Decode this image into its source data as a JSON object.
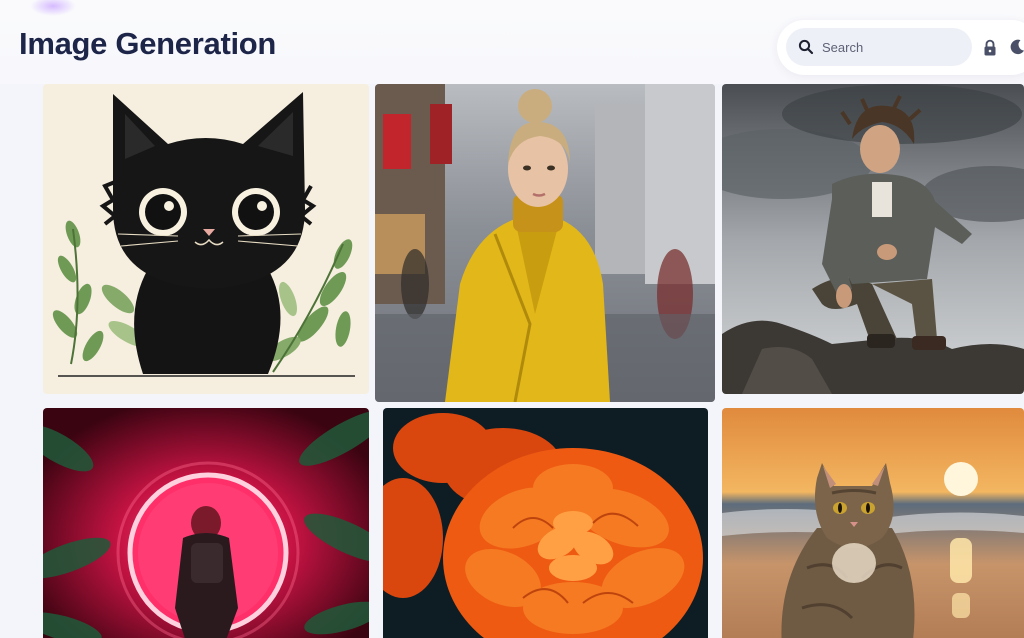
{
  "header": {
    "title": "Image Generation"
  },
  "search": {
    "placeholder": "Search"
  },
  "icons": {
    "search": "search-icon",
    "lock": "lock-icon",
    "theme": "moon-icon"
  },
  "colors": {
    "title": "#1d2548",
    "page_bg": "#f4f5fa",
    "search_bg": "#eef0f8"
  },
  "gallery": {
    "images": [
      {
        "subject": "black cat illustration with leaves"
      },
      {
        "subject": "woman in yellow coat on city street"
      },
      {
        "subject": "young man crouching on rocks under cloudy sky"
      },
      {
        "subject": "figure walking into neon red ring portal"
      },
      {
        "subject": "orange marigold flower close-up"
      },
      {
        "subject": "tabby cat on beach at sunset"
      }
    ]
  }
}
